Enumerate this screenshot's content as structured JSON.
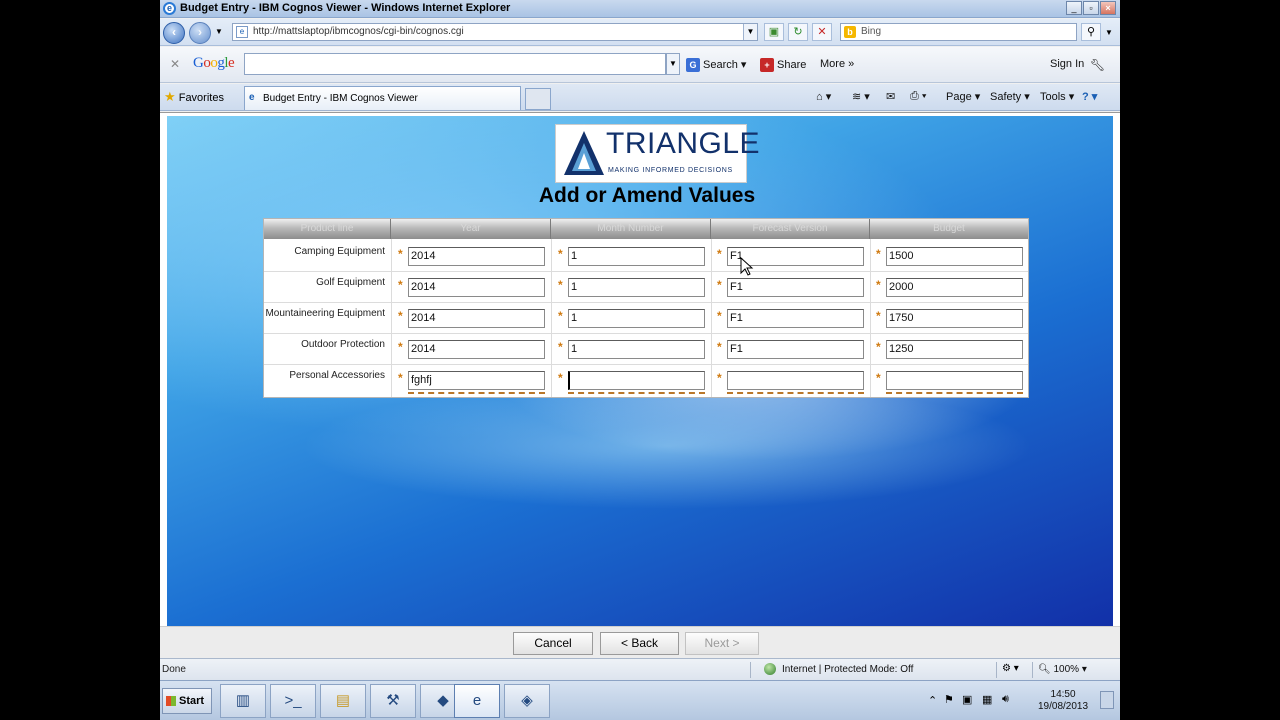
{
  "window": {
    "title": "Budget Entry - IBM Cognos Viewer - Windows Internet Explorer",
    "controls": [
      "_",
      "▫",
      "×"
    ]
  },
  "address_bar": {
    "url": "http://mattslaptop/ibmcognos/cgi-bin/cognos.cgi",
    "search_placeholder": "Bing"
  },
  "google_toolbar": {
    "logo": "Google",
    "search_value": "",
    "search_label": "Search",
    "share_label": "Share",
    "more_label": "More",
    "more_arrows": "»",
    "sign_in_label": "Sign In"
  },
  "tabs": {
    "favorites_label": "Favorites",
    "active_tab_label": "Budget Entry - IBM Cognos Viewer"
  },
  "command_bar": {
    "page_label": "Page",
    "safety_label": "Safety",
    "tools_label": "Tools"
  },
  "page": {
    "logo": {
      "name": "TRIANGLE",
      "tagline": "MAKING INFORMED DECISIONS",
      "colors": {
        "brand": "#12316b"
      }
    },
    "heading": "Add or Amend Values",
    "grid": {
      "columns": [
        "Product line",
        "Year",
        "Month Number",
        "Forecast Version",
        "Budget"
      ],
      "rows": [
        {
          "product_line": "Camping Equipment",
          "year": "2014",
          "month": "1",
          "forecast": "F1",
          "budget": "1500"
        },
        {
          "product_line": "Golf Equipment",
          "year": "2014",
          "month": "1",
          "forecast": "F1",
          "budget": "2000"
        },
        {
          "product_line": "Mountaineering Equipment",
          "year": "2014",
          "month": "1",
          "forecast": "F1",
          "budget": "1750"
        },
        {
          "product_line": "Outdoor Protection",
          "year": "2014",
          "month": "1",
          "forecast": "F1",
          "budget": "1250"
        },
        {
          "product_line": "Personal Accessories",
          "year": "fghfj",
          "month": "",
          "forecast": "",
          "budget": ""
        }
      ],
      "required_marker": "*"
    },
    "buttons": {
      "cancel": "Cancel",
      "back": "< Back",
      "next": "Next >"
    }
  },
  "status_bar": {
    "text": "Done",
    "zone": "Internet | Protected Mode: Off",
    "zoom": "100%"
  },
  "taskbar": {
    "start_label": "Start",
    "time": "14:50",
    "date": "19/08/2013"
  }
}
